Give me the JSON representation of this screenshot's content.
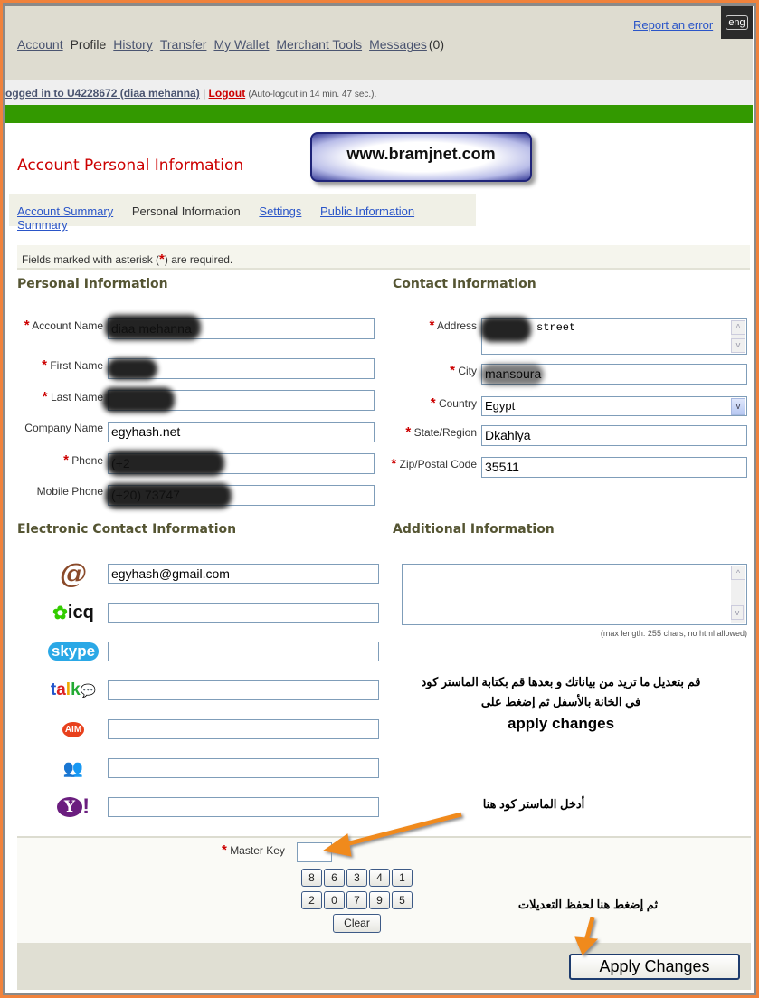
{
  "header": {
    "report_error": "Report an error",
    "language": "eng",
    "nav": [
      {
        "label": "Account",
        "link": true
      },
      {
        "label": "Profile",
        "link": false
      },
      {
        "label": "History",
        "link": true
      },
      {
        "label": "Transfer",
        "link": true
      },
      {
        "label": "My Wallet",
        "link": true
      },
      {
        "label": "Merchant Tools",
        "link": true
      },
      {
        "label": "Messages",
        "link": true
      }
    ],
    "messages_count": "(0)"
  },
  "login_bar": {
    "prefix": "ogged in to U4228672 (diaa mehanna)",
    "separator": "|",
    "logout": "Logout",
    "auto_logout": "(Auto-logout in 14 min. 47 sec.)."
  },
  "watermark": "www.bramjnet.com",
  "page_title": "Account Personal Information",
  "subtabs": [
    "Account Summary",
    "Personal Information",
    "Settings",
    "Public Information Summary"
  ],
  "required_note": {
    "before": "Fields marked with asterisk (",
    "star": "*",
    "after": ") are required."
  },
  "personal": {
    "title": "Personal Information",
    "fields": [
      {
        "label": "Account Name",
        "value": "diaa mehanna",
        "required": true
      },
      {
        "label": "First Name",
        "value": "",
        "required": true
      },
      {
        "label": "Last Name",
        "value": "",
        "required": true
      },
      {
        "label": "Company Name",
        "value": "egyhash.net",
        "required": false
      },
      {
        "label": "Phone",
        "value": "(+2",
        "required": true
      },
      {
        "label": "Mobile Phone",
        "value": "(+20) 73747",
        "required": false
      }
    ]
  },
  "contact": {
    "title": "Contact Information",
    "fields": [
      {
        "label": "Address",
        "value": "street",
        "required": true
      },
      {
        "label": "City",
        "value": "mansoura",
        "required": true
      },
      {
        "label": "Country",
        "value": "Egypt",
        "required": true
      },
      {
        "label": "State/Region",
        "value": "Dkahlya",
        "required": true
      },
      {
        "label": "Zip/Postal Code",
        "value": "35511",
        "required": true
      }
    ]
  },
  "electronic": {
    "title": "Electronic Contact Information",
    "fields": [
      {
        "icon": "email-icon",
        "value": "egyhash@gmail.com"
      },
      {
        "icon": "icq-icon",
        "value": "",
        "icon_text": "icq"
      },
      {
        "icon": "skype-icon",
        "value": "",
        "icon_text": "skype"
      },
      {
        "icon": "google-talk-icon",
        "value": "",
        "icon_text": "talk"
      },
      {
        "icon": "aim-icon",
        "value": "",
        "icon_text": "AIM"
      },
      {
        "icon": "msn-messenger-icon",
        "value": ""
      },
      {
        "icon": "yahoo-icon",
        "value": "",
        "icon_text": "Y!"
      }
    ]
  },
  "additional": {
    "title": "Additional Information",
    "value": "",
    "hint": "(max length: 255 chars, no html allowed)"
  },
  "annotations": {
    "instructions_1": "قم بتعديل ما تريد من بياناتك و بعدها قم بكتابة الماستر كود",
    "instructions_2": "في الخانة بالأسفل ثم إضغط على",
    "instructions_3": "apply changes",
    "master_hint": "أدخل الماستر كود هنا",
    "apply_hint": "ثم إضغط هنا لحفظ التعديلات",
    "arrow_color": "#f08a1c"
  },
  "master_key": {
    "label": "Master Key",
    "value": "",
    "keypad": [
      "8",
      "6",
      "3",
      "4",
      "1",
      "2",
      "0",
      "7",
      "9",
      "5"
    ],
    "clear": "Clear"
  },
  "apply_button": "Apply Changes",
  "colors": {
    "title": "#cc0000",
    "green_bar": "#339900",
    "header_bg": "#dedcd0",
    "section": "#555533"
  }
}
